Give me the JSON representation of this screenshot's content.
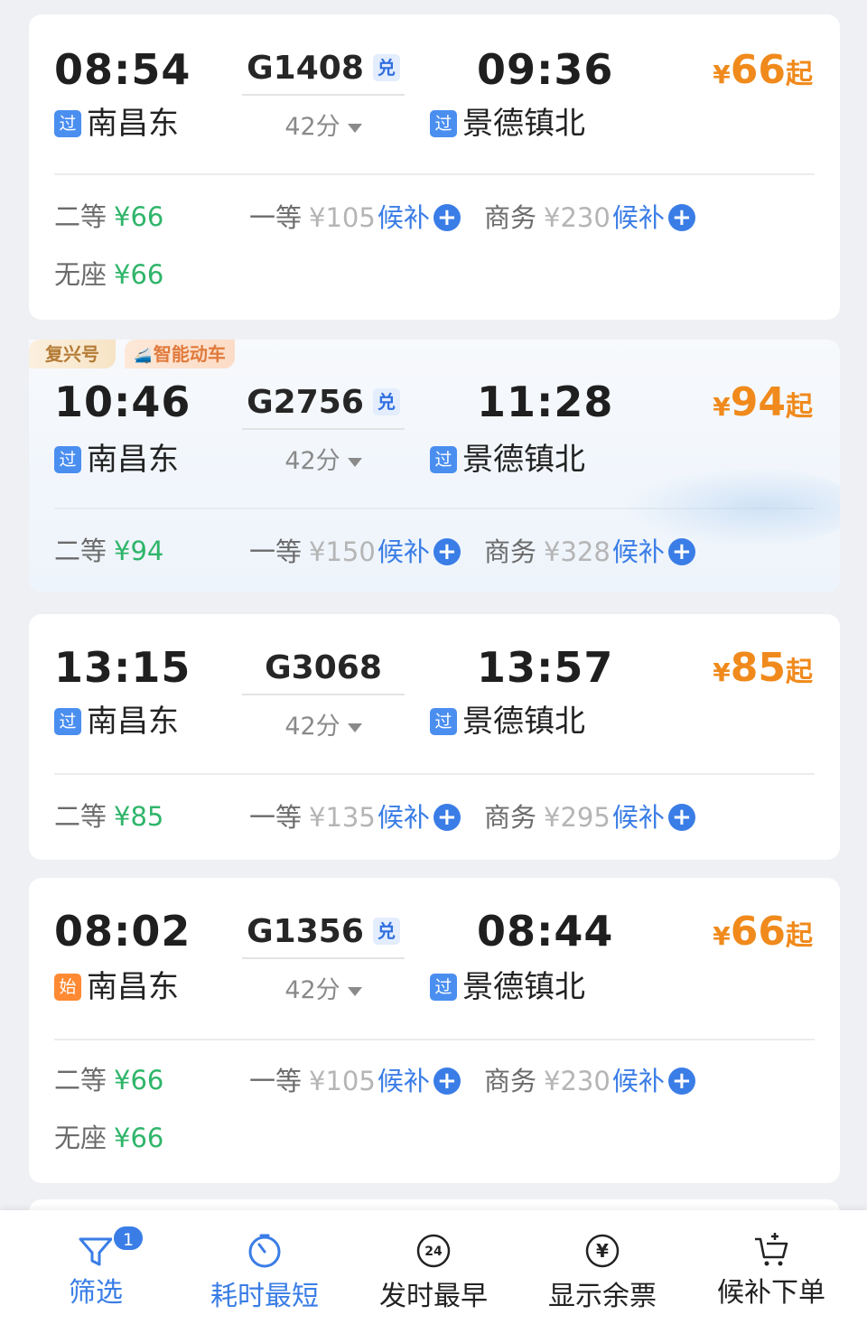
{
  "trains": [
    {
      "dep_time": "08:54",
      "dep_station": "南昌东",
      "dep_badge": "过",
      "train_no": "G1408",
      "exchange_tag": "兑",
      "duration": "42分",
      "arr_time": "09:36",
      "arr_station": "景德镇北",
      "arr_badge": "过",
      "min_price": {
        "currency": "¥",
        "value": "66",
        "suffix": "起"
      },
      "seats": [
        {
          "name": "二等",
          "price": "¥66"
        },
        {
          "name": "一等",
          "price": "¥105",
          "waitlist": "候补"
        },
        {
          "name": "商务",
          "price": "¥230",
          "waitlist": "候补"
        },
        {
          "name": "无座",
          "price": "¥66"
        }
      ]
    },
    {
      "tags": [
        "复兴号",
        "智能动车"
      ],
      "dep_time": "10:46",
      "dep_station": "南昌东",
      "dep_badge": "过",
      "train_no": "G2756",
      "exchange_tag": "兑",
      "duration": "42分",
      "arr_time": "11:28",
      "arr_station": "景德镇北",
      "arr_badge": "过",
      "min_price": {
        "currency": "¥",
        "value": "94",
        "suffix": "起"
      },
      "seats": [
        {
          "name": "二等",
          "price": "¥94"
        },
        {
          "name": "一等",
          "price": "¥150",
          "waitlist": "候补"
        },
        {
          "name": "商务",
          "price": "¥328",
          "waitlist": "候补"
        }
      ]
    },
    {
      "dep_time": "13:15",
      "dep_station": "南昌东",
      "dep_badge": "过",
      "train_no": "G3068",
      "duration": "42分",
      "arr_time": "13:57",
      "arr_station": "景德镇北",
      "arr_badge": "过",
      "min_price": {
        "currency": "¥",
        "value": "85",
        "suffix": "起"
      },
      "seats": [
        {
          "name": "二等",
          "price": "¥85"
        },
        {
          "name": "一等",
          "price": "¥135",
          "waitlist": "候补"
        },
        {
          "name": "商务",
          "price": "¥295",
          "waitlist": "候补"
        }
      ]
    },
    {
      "dep_time": "08:02",
      "dep_station": "南昌东",
      "dep_badge": "始",
      "train_no": "G1356",
      "exchange_tag": "兑",
      "duration": "42分",
      "arr_time": "08:44",
      "arr_station": "景德镇北",
      "arr_badge": "过",
      "min_price": {
        "currency": "¥",
        "value": "66",
        "suffix": "起"
      },
      "seats": [
        {
          "name": "二等",
          "price": "¥66"
        },
        {
          "name": "一等",
          "price": "¥105",
          "waitlist": "候补"
        },
        {
          "name": "商务",
          "price": "¥230",
          "waitlist": "候补"
        },
        {
          "name": "无座",
          "price": "¥66"
        }
      ]
    }
  ],
  "bottom_bar": {
    "filter": {
      "label": "筛选",
      "badge": "1",
      "icon": "filter-icon"
    },
    "shortest": {
      "label": "耗时最短",
      "icon": "timer-icon"
    },
    "earliest": {
      "label": "发时最早",
      "icon": "clock-24-icon",
      "icon_text": "24"
    },
    "tickets": {
      "label": "显示余票",
      "icon": "yuan-icon",
      "icon_text": "¥"
    },
    "waitlist_order": {
      "label": "候补下单",
      "icon": "cart-plus-icon"
    }
  },
  "colors": {
    "accent_blue": "#3a7de6",
    "price_orange": "#f08a1c",
    "price_green": "#2fb56a"
  }
}
